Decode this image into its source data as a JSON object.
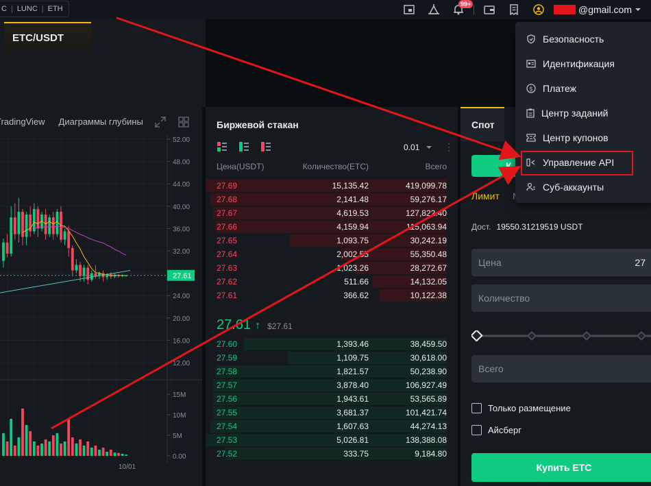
{
  "topbar": {
    "tickers": [
      "C",
      "LUNC",
      "ETH"
    ],
    "notification_badge": "99+",
    "email_suffix": "@gmail.com",
    "icons": [
      "orders-icon",
      "announcement-icon",
      "bell-icon",
      "wallet-icon",
      "receipt-icon",
      "user-icon"
    ]
  },
  "pair": {
    "symbol": "ETC/USDT"
  },
  "chart": {
    "tabs": [
      "TradingView",
      "Диаграммы глубины"
    ],
    "price_tag": "27.61",
    "date_label": "10/01"
  },
  "chart_data": {
    "type": "candlestick",
    "price_axis": [
      "52.00",
      "48.00",
      "44.00",
      "40.00",
      "36.00",
      "32.00",
      "28.00",
      "24.00",
      "20.00",
      "16.00",
      "12.00"
    ],
    "price_range": [
      12,
      52
    ],
    "volume_axis": [
      "15M",
      "10M",
      "5M",
      "0.00"
    ],
    "volume_range": [
      0,
      15000000
    ],
    "candles": [
      {
        "o": 30.2,
        "c": 33.5,
        "h": 34.2,
        "l": 29.0,
        "v": 5500000
      },
      {
        "o": 33.5,
        "c": 31.5,
        "h": 35.0,
        "l": 30.8,
        "v": 3500000
      },
      {
        "o": 31.5,
        "c": 38.0,
        "h": 40.0,
        "l": 31.0,
        "v": 9000000
      },
      {
        "o": 38.0,
        "c": 35.0,
        "h": 40.5,
        "l": 34.0,
        "v": 2500000
      },
      {
        "o": 35.0,
        "c": 39.0,
        "h": 41.5,
        "l": 33.5,
        "v": 4500000
      },
      {
        "o": 39.0,
        "c": 34.5,
        "h": 39.5,
        "l": 33.0,
        "v": 11500000
      },
      {
        "o": 34.5,
        "c": 38.5,
        "h": 39.0,
        "l": 33.0,
        "v": 7500000
      },
      {
        "o": 38.5,
        "c": 35.5,
        "h": 40.0,
        "l": 34.5,
        "v": 6000000
      },
      {
        "o": 35.5,
        "c": 39.5,
        "h": 40.5,
        "l": 35.0,
        "v": 3500000
      },
      {
        "o": 39.5,
        "c": 36.0,
        "h": 40.0,
        "l": 34.5,
        "v": 2500000
      },
      {
        "o": 36.0,
        "c": 38.5,
        "h": 39.0,
        "l": 35.5,
        "v": 3000000
      },
      {
        "o": 38.5,
        "c": 35.0,
        "h": 39.5,
        "l": 34.0,
        "v": 4000000
      },
      {
        "o": 35.0,
        "c": 38.0,
        "h": 38.5,
        "l": 34.5,
        "v": 3500000
      },
      {
        "o": 38.0,
        "c": 35.0,
        "h": 39.0,
        "l": 34.0,
        "v": 5000000
      },
      {
        "o": 35.0,
        "c": 39.0,
        "h": 39.5,
        "l": 34.5,
        "v": 5500000
      },
      {
        "o": 39.0,
        "c": 34.0,
        "h": 40.0,
        "l": 33.5,
        "v": 3000000
      },
      {
        "o": 34.0,
        "c": 35.5,
        "h": 36.0,
        "l": 33.0,
        "v": 3500000
      },
      {
        "o": 35.5,
        "c": 32.5,
        "h": 36.5,
        "l": 31.0,
        "v": 9000000
      },
      {
        "o": 32.5,
        "c": 28.5,
        "h": 33.0,
        "l": 27.5,
        "v": 4500000
      },
      {
        "o": 28.5,
        "c": 29.5,
        "h": 30.5,
        "l": 28.0,
        "v": 3000000
      },
      {
        "o": 29.5,
        "c": 27.5,
        "h": 30.0,
        "l": 26.5,
        "v": 4000000
      },
      {
        "o": 27.5,
        "c": 29.0,
        "h": 29.5,
        "l": 26.5,
        "v": 2500000
      },
      {
        "o": 29.0,
        "c": 26.8,
        "h": 29.5,
        "l": 26.0,
        "v": 3500000
      },
      {
        "o": 26.8,
        "c": 28.0,
        "h": 28.5,
        "l": 26.5,
        "v": 2000000
      },
      {
        "o": 28.0,
        "c": 27.5,
        "h": 29.5,
        "l": 27.0,
        "v": 2500000
      },
      {
        "o": 27.5,
        "c": 28.0,
        "h": 28.3,
        "l": 27.0,
        "v": 1500000
      },
      {
        "o": 28.0,
        "c": 27.3,
        "h": 28.5,
        "l": 26.5,
        "v": 2000000
      },
      {
        "o": 27.3,
        "c": 27.8,
        "h": 28.0,
        "l": 26.8,
        "v": 1000000
      },
      {
        "o": 27.8,
        "c": 27.4,
        "h": 28.2,
        "l": 27.0,
        "v": 1500000
      },
      {
        "o": 27.4,
        "c": 27.7,
        "h": 27.9,
        "l": 27.1,
        "v": 800000
      },
      {
        "o": 27.7,
        "c": 27.5,
        "h": 27.9,
        "l": 27.2,
        "v": 700000
      },
      {
        "o": 27.5,
        "c": 27.6,
        "h": 27.8,
        "l": 27.3,
        "v": 500000
      },
      {
        "o": 27.6,
        "c": 27.6,
        "h": 27.7,
        "l": 27.4,
        "v": 300000
      }
    ]
  },
  "orderbook": {
    "title": "Биржевой стакан",
    "precision": "0.01",
    "headers": {
      "price": "Цена(USDT)",
      "qty": "Количество(ETC)",
      "total": "Всего"
    },
    "asks": [
      {
        "price": "27.69",
        "qty": "15,135.42",
        "total": "419,099.78",
        "depth": 1.0
      },
      {
        "price": "27.68",
        "qty": "2,141.48",
        "total": "59,276.17",
        "depth": 0.98
      },
      {
        "price": "27.67",
        "qty": "4,619.53",
        "total": "127,822.40",
        "depth": 0.97
      },
      {
        "price": "27.66",
        "qty": "4,159.94",
        "total": "115,063.94",
        "depth": 0.96
      },
      {
        "price": "27.65",
        "qty": "1,093.75",
        "total": "30,242.19",
        "depth": 0.65
      },
      {
        "price": "27.64",
        "qty": "2,002.55",
        "total": "55,350.48",
        "depth": 0.44
      },
      {
        "price": "27.63",
        "qty": "1,023.26",
        "total": "28,272.67",
        "depth": 0.38
      },
      {
        "price": "27.62",
        "qty": "511.66",
        "total": "14,132.05",
        "depth": 0.31
      },
      {
        "price": "27.61",
        "qty": "366.62",
        "total": "10,122.38",
        "depth": 0.28
      }
    ],
    "last_price": "27.61",
    "last_price_usd": "$27.61",
    "bids": [
      {
        "price": "27.60",
        "qty": "1,393.46",
        "total": "38,459.50",
        "depth": 0.84
      },
      {
        "price": "27.59",
        "qty": "1,109.75",
        "total": "30,618.00",
        "depth": 0.66
      },
      {
        "price": "27.58",
        "qty": "1,821.57",
        "total": "50,238.90",
        "depth": 0.96
      },
      {
        "price": "27.57",
        "qty": "3,878.40",
        "total": "106,927.49",
        "depth": 0.97
      },
      {
        "price": "27.56",
        "qty": "1,943.61",
        "total": "53,565.89",
        "depth": 0.97
      },
      {
        "price": "27.55",
        "qty": "3,681.37",
        "total": "101,421.74",
        "depth": 0.97
      },
      {
        "price": "27.54",
        "qty": "1,607.63",
        "total": "44,274.13",
        "depth": 0.98
      },
      {
        "price": "27.53",
        "qty": "5,026.81",
        "total": "138,388.08",
        "depth": 1.0
      },
      {
        "price": "27.52",
        "qty": "333.75",
        "total": "9,184.80",
        "depth": 0.92
      }
    ]
  },
  "trade": {
    "spot_tab": "Спот",
    "buy_tab": "К",
    "limit_tab": "Лимит",
    "market_tab": "М",
    "avail_label": "Дост.",
    "avail_value": "19550.31219519 USDT",
    "price_label": "Цена",
    "price_value": "27",
    "qty_label": "Количество",
    "total_label": "Всего",
    "post_only": "Только размещение",
    "iceberg": "Айсберг",
    "buy_button": "Купить ETC"
  },
  "dropdown": {
    "items": [
      {
        "label": "Безопасность",
        "icon": "shield-icon"
      },
      {
        "label": "Идентификация",
        "icon": "id-card-icon"
      },
      {
        "label": "Платеж",
        "icon": "dollar-icon"
      },
      {
        "label": "Центр заданий",
        "icon": "clipboard-icon"
      },
      {
        "label": "Центр купонов",
        "icon": "coupon-icon"
      },
      {
        "label": "Управление API",
        "icon": "api-icon"
      },
      {
        "label": "Суб-аккаунты",
        "icon": "sub-account-icon"
      }
    ],
    "highlighted": "Управление API"
  },
  "colors": {
    "accent": "#f0b90b",
    "buy": "#0ecb81",
    "sell": "#f6465d",
    "annotation": "#e0161b"
  }
}
